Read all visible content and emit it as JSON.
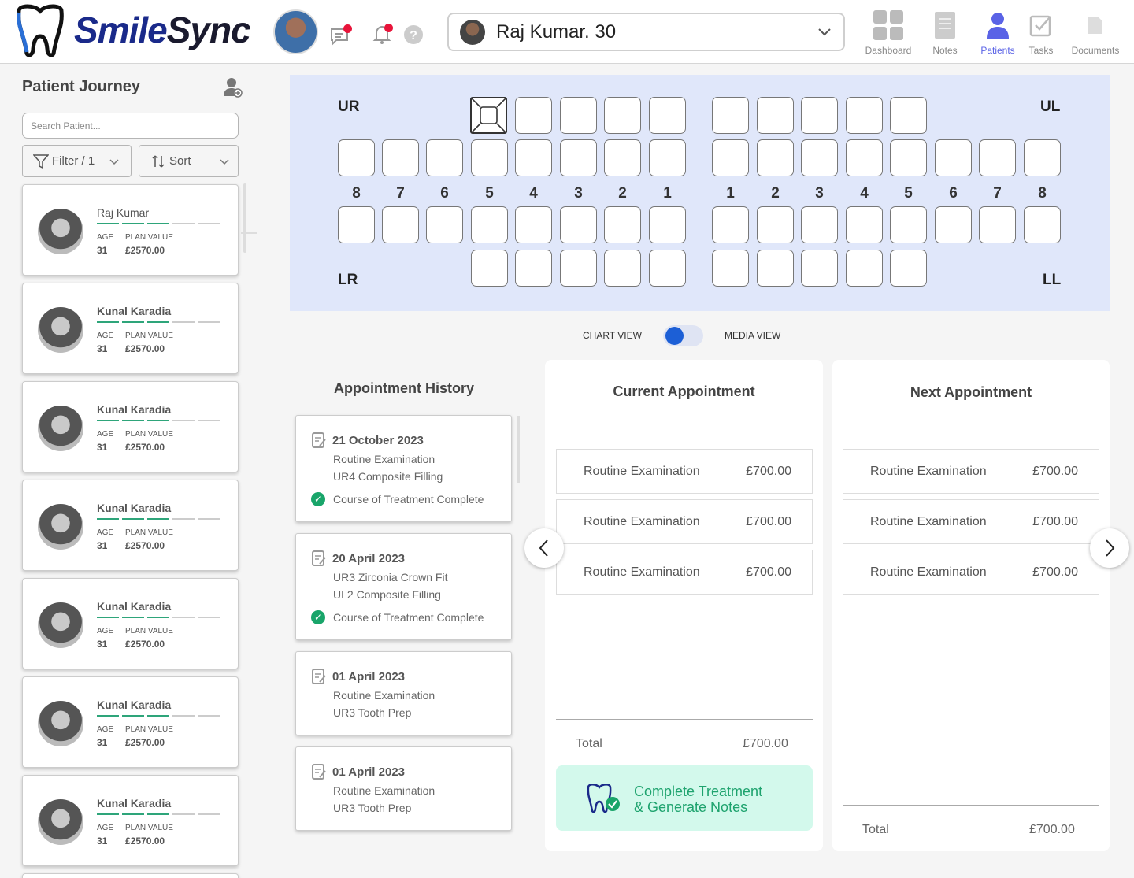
{
  "app": {
    "name_part1": "Smile",
    "name_part2": "Sync"
  },
  "header": {
    "patient_selected": "Raj Kumar. 30",
    "nav": [
      {
        "label": "Dashboard",
        "icon": "dashboard-icon"
      },
      {
        "label": "Notes",
        "icon": "notes-icon"
      },
      {
        "label": "Patients",
        "icon": "patients-icon",
        "active": true
      },
      {
        "label": "Tasks",
        "icon": "tasks-icon"
      },
      {
        "label": "Documents",
        "icon": "documents-icon"
      }
    ]
  },
  "sidebar": {
    "title": "Patient Journey",
    "search_placeholder": "Search Patient...",
    "filter_label": "Filter / 1",
    "sort_label": "Sort",
    "patients": [
      {
        "name": "Raj Kumar",
        "age_label": "AGE",
        "age": "31",
        "plan_label": "PLAN VALUE",
        "plan": "£2570.00",
        "progress": 3
      },
      {
        "name": "Kunal Karadia",
        "age_label": "AGE",
        "age": "31",
        "plan_label": "PLAN VALUE",
        "plan": "£2570.00",
        "progress": 3
      },
      {
        "name": "Kunal Karadia",
        "age_label": "AGE",
        "age": "31",
        "plan_label": "PLAN VALUE",
        "plan": "£2570.00",
        "progress": 3
      },
      {
        "name": "Kunal Karadia",
        "age_label": "AGE",
        "age": "31",
        "plan_label": "PLAN VALUE",
        "plan": "£2570.00",
        "progress": 3
      },
      {
        "name": "Kunal Karadia",
        "age_label": "AGE",
        "age": "31",
        "plan_label": "PLAN VALUE",
        "plan": "£2570.00",
        "progress": 3
      },
      {
        "name": "Kunal Karadia",
        "age_label": "AGE",
        "age": "31",
        "plan_label": "PLAN VALUE",
        "plan": "£2570.00",
        "progress": 3
      },
      {
        "name": "Kunal Karadia",
        "age_label": "AGE",
        "age": "31",
        "plan_label": "PLAN VALUE",
        "plan": "£2570.00",
        "progress": 3
      }
    ]
  },
  "chart": {
    "quadrants": {
      "ur": "UR",
      "ul": "UL",
      "lr": "LR",
      "ll": "LL"
    },
    "numbers_left": [
      "8",
      "7",
      "6",
      "5",
      "4",
      "3",
      "2",
      "1"
    ],
    "numbers_right": [
      "1",
      "2",
      "3",
      "4",
      "5",
      "6",
      "7",
      "8"
    ],
    "marked_tooth": "UR5"
  },
  "view_toggle": {
    "left": "CHART VIEW",
    "right": "MEDIA VIEW",
    "state": "chart"
  },
  "history": {
    "title": "Appointment History",
    "items": [
      {
        "date": "21 October 2023",
        "lines": [
          "Routine Examination",
          "UR4 Composite Filling"
        ],
        "status": "Course of Treatment Complete"
      },
      {
        "date": "20 April 2023",
        "lines": [
          "UR3 Zirconia Crown Fit",
          "UL2 Composite Filling"
        ],
        "status": "Course of Treatment Complete"
      },
      {
        "date": "01 April 2023",
        "lines": [
          "Routine Examination",
          "UR3 Tooth Prep"
        ],
        "status": ""
      },
      {
        "date": "01 April 2023",
        "lines": [
          "Routine Examination",
          "UR3 Tooth Prep"
        ],
        "status": ""
      }
    ]
  },
  "current": {
    "title": "Current Appointment",
    "items": [
      {
        "name": "Routine Examination",
        "price": "£700.00"
      },
      {
        "name": "Routine Examination",
        "price": "£700.00"
      },
      {
        "name": "Routine Examination",
        "price": "£700.00"
      }
    ],
    "total_label": "Total",
    "total": "£700.00",
    "cta_line1": "Complete Treatment",
    "cta_line2": "& Generate Notes"
  },
  "next": {
    "title": "Next Appointment",
    "items": [
      {
        "name": "Routine Examination",
        "price": "£700.00"
      },
      {
        "name": "Routine Examination",
        "price": "£700.00"
      },
      {
        "name": "Routine Examination",
        "price": "£700.00"
      }
    ],
    "total_label": "Total",
    "total": "£700.00"
  },
  "colors": {
    "accent": "#5a63e6",
    "brand": "#1a2a8a",
    "success": "#19a56a",
    "chart_bg": "#e0e7fa",
    "cta_bg": "#d3f9ec",
    "toggle_knob": "#1c5fd6"
  }
}
